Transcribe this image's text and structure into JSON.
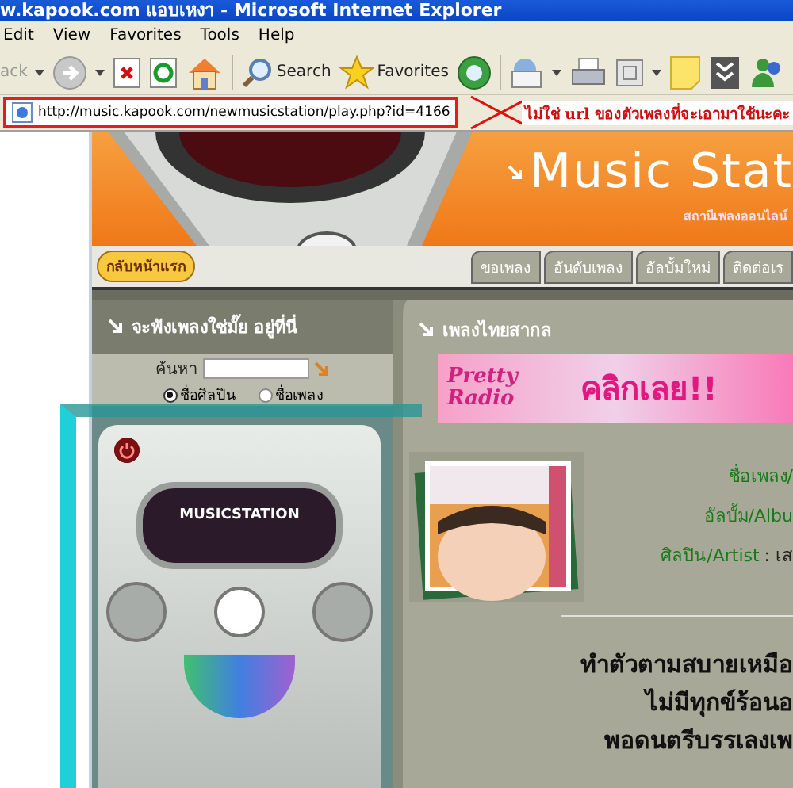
{
  "window": {
    "title": "w.kapook.com แอบเหงา - Microsoft Internet Explorer"
  },
  "menu": [
    "Edit",
    "View",
    "Favorites",
    "Tools",
    "Help"
  ],
  "toolbar": [
    {
      "kind": "back",
      "label": "ack"
    },
    {
      "kind": "forward"
    },
    {
      "kind": "stop"
    },
    {
      "kind": "refresh"
    },
    {
      "kind": "home"
    },
    {
      "kind": "search",
      "label": "Search"
    },
    {
      "kind": "favorites",
      "label": "Favorites"
    },
    {
      "kind": "media"
    },
    {
      "kind": "mail"
    },
    {
      "kind": "print"
    },
    {
      "kind": "edit"
    },
    {
      "kind": "note"
    },
    {
      "kind": "archive"
    },
    {
      "kind": "messenger"
    }
  ],
  "address": {
    "url": "http://music.kapook.com/newmusicstation/play.php?id=4166"
  },
  "annotation": {
    "note": "ไม่ใช่ url ของตัวเพลงที่จะเอามาใช้นะคะ"
  },
  "site": {
    "title": "Music Stat",
    "subtitle": "สถานีเพลงออนไลน์",
    "home_button": "กลับหน้าแรก",
    "tabs": [
      "ขอเพลง",
      "อันดับเพลง",
      "อัลบั้มใหม่",
      "ติดต่อเร"
    ]
  },
  "search_panel": {
    "heading": "จะฟังเพลงใช่มั๊ย อยู่ที่นี่",
    "label": "ค้นหา",
    "options": [
      {
        "label": "ชื่อศิลปิน",
        "selected": true
      },
      {
        "label": "ชื่อเพลง",
        "selected": false
      }
    ]
  },
  "player": {
    "display": "MUSICSTATION"
  },
  "content": {
    "heading": "เพลงไทยสากล",
    "banner": {
      "title": "Pretty Radio",
      "action": "คลิกเลย!!"
    },
    "fields": [
      {
        "label": "ชื่อเพลง/"
      },
      {
        "label": "อัลบั้ม/Albu"
      },
      {
        "label": "ศิลปิน/Artist",
        "value": ": เส"
      }
    ],
    "lyrics": [
      "ทำตัวตามสบายเหมือ",
      "ไม่มีทุกข์ร้อนอ",
      "พอดนตรีบรรเลงเพ"
    ]
  }
}
